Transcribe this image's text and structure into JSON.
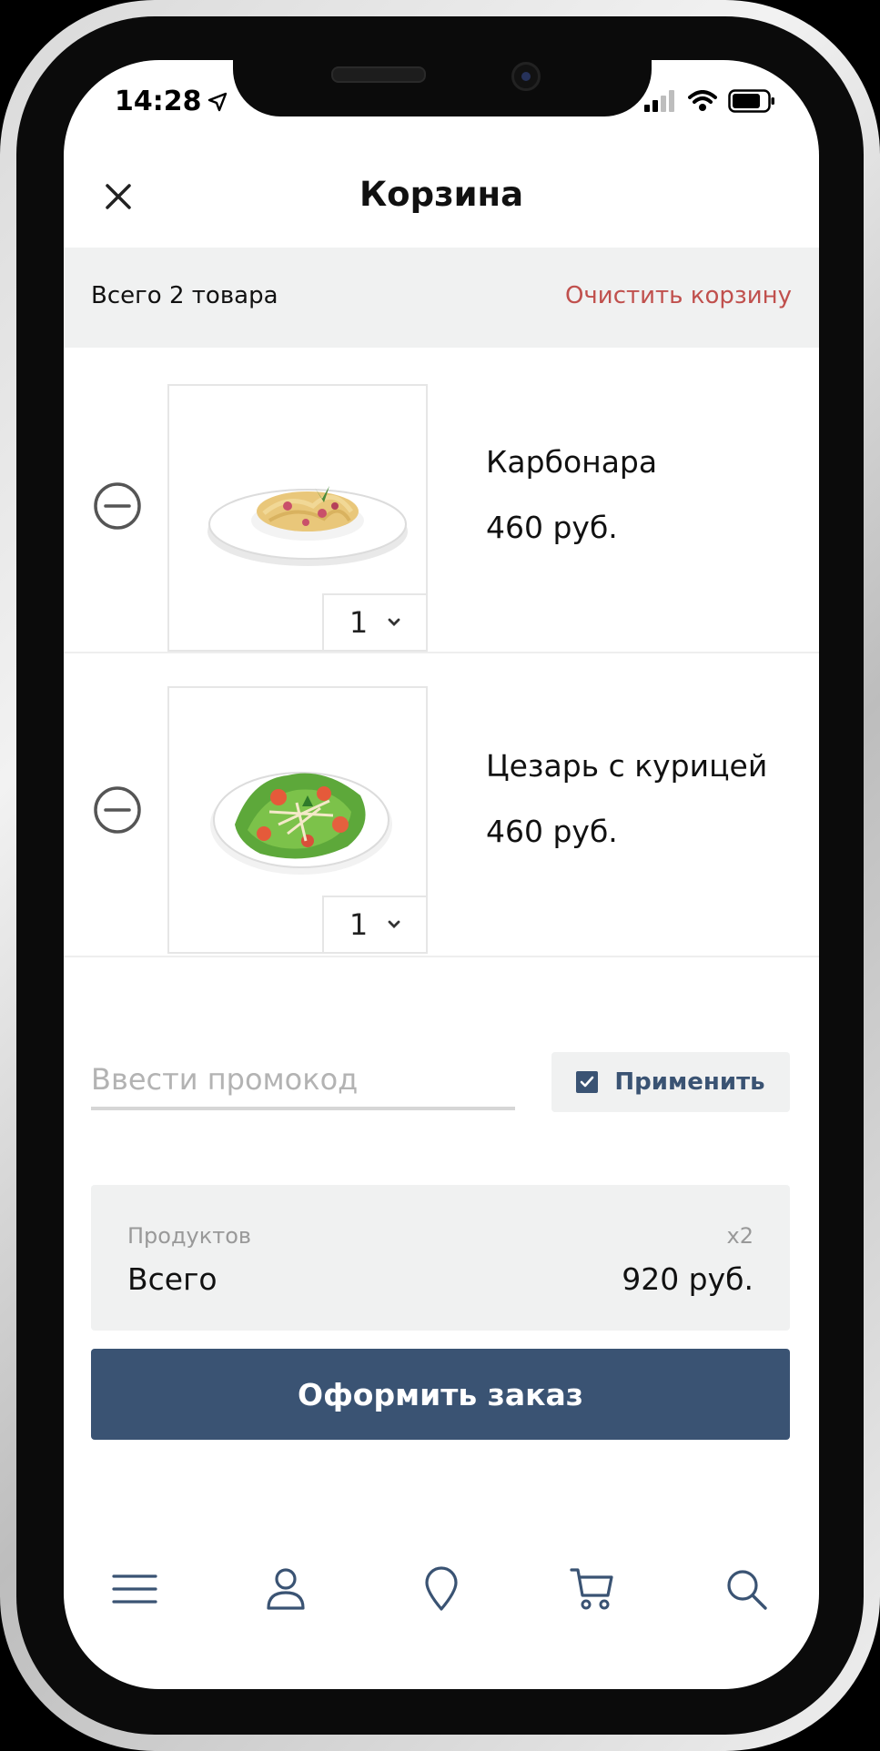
{
  "status_bar": {
    "time": "14:28"
  },
  "header": {
    "title": "Корзина",
    "close_icon": "close-icon"
  },
  "summary": {
    "count_text": "Всего 2 товара",
    "clear_label": "Очистить корзину"
  },
  "items": [
    {
      "name": "Карбонара",
      "price": "460 руб.",
      "quantity": "1"
    },
    {
      "name": "Цезарь с курицей",
      "price": "460 руб.",
      "quantity": "1"
    }
  ],
  "promo": {
    "placeholder": "Ввести промокод",
    "apply_label": "Применить"
  },
  "totals": {
    "products_label": "Продуктов",
    "multiplier": "x2",
    "total_label": "Всего",
    "total_amount": "920 руб."
  },
  "checkout": {
    "label": "Оформить заказ"
  },
  "tabbar": {
    "icons": [
      "menu-icon",
      "user-icon",
      "location-pin-icon",
      "cart-icon",
      "search-icon"
    ]
  },
  "colors": {
    "accent": "#3a5373",
    "danger": "#c0504d",
    "panel": "#f0f1f1"
  }
}
